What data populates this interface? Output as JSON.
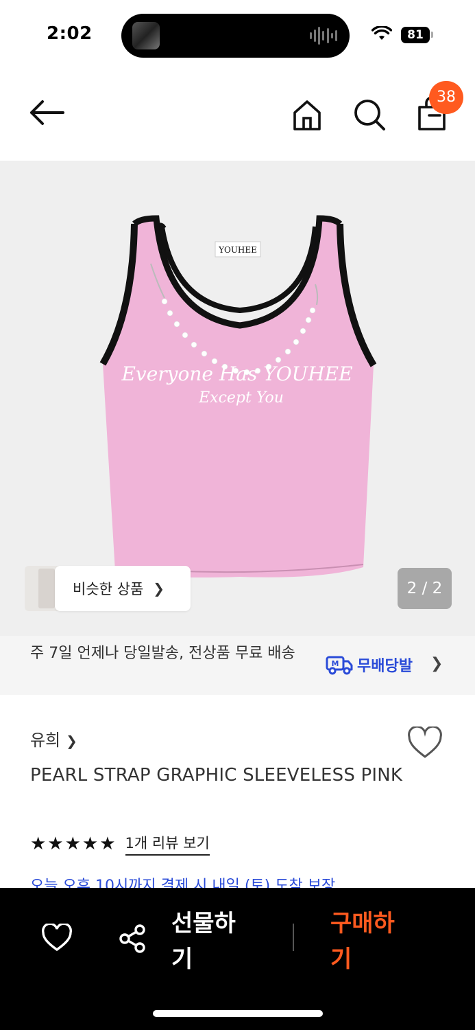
{
  "status_bar": {
    "time": "2:02",
    "battery": "81"
  },
  "nav": {
    "cart_count": "38"
  },
  "gallery": {
    "similar_label": "비슷한 상품",
    "counter": "2 / 2"
  },
  "shipping": {
    "text": "주 7일 언제나 당일발송, 전상품 무료 배송",
    "badge_label": "무배당발"
  },
  "product": {
    "brand": "유희",
    "title": "PEARL STRAP GRAPHIC SLEEVELESS PINK",
    "rating_stars": "★★★★★",
    "review_link": "1개 리뷰 보기",
    "partial_notice": "오늘 오후 10시까지 결제 시 내일 (토) 도착 보장"
  },
  "bottom_bar": {
    "gift_label": "선물하기",
    "buy_label": "구매하기"
  },
  "colors": {
    "accent": "#ff5a1f",
    "blue": "#2a4bd8",
    "shirt": "#f0b4d8"
  },
  "icons": [
    "back-arrow-icon",
    "home-icon",
    "search-icon",
    "shopping-bag-icon",
    "heart-icon",
    "share-icon",
    "truck-icon",
    "wifi-icon"
  ]
}
